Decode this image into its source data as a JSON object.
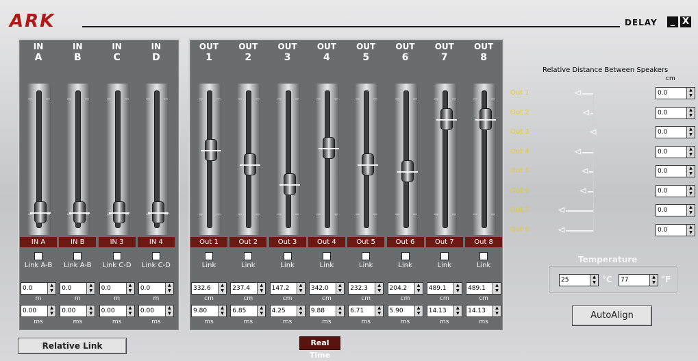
{
  "app": {
    "logo": "ARK",
    "title": "DELAY",
    "minimize": "_",
    "close": "X"
  },
  "inputs": [
    {
      "header": "IN",
      "ch": "A",
      "label": "IN A",
      "link": "Link A-B",
      "value": "0.0",
      "ms": "0.00",
      "unit_top": "m",
      "unit_bottom": "ms",
      "level": 0.05
    },
    {
      "header": "IN",
      "ch": "B",
      "label": "IN B",
      "link": "Link A-B",
      "value": "0.0",
      "ms": "0.00",
      "unit_top": "m",
      "unit_bottom": "ms",
      "level": 0.05
    },
    {
      "header": "IN",
      "ch": "C",
      "label": "IN 3",
      "link": "Link C-D",
      "value": "0.0",
      "ms": "0.00",
      "unit_top": "m",
      "unit_bottom": "ms",
      "level": 0.05
    },
    {
      "header": "IN",
      "ch": "D",
      "label": "IN 4",
      "link": "Link C-D",
      "value": "0.0",
      "ms": "0.00",
      "unit_top": "m",
      "unit_bottom": "ms",
      "level": 0.05
    }
  ],
  "outputs": [
    {
      "header": "OUT",
      "ch": "1",
      "label": "Out 1",
      "link": "Link",
      "value": "332.6",
      "ms": "9.80",
      "unit_top": "cm",
      "unit_bottom": "ms",
      "level": 0.58
    },
    {
      "header": "OUT",
      "ch": "2",
      "label": "Out 2",
      "link": "Link",
      "value": "237.4",
      "ms": "6.85",
      "unit_top": "cm",
      "unit_bottom": "ms",
      "level": 0.46
    },
    {
      "header": "OUT",
      "ch": "3",
      "label": "Out 3",
      "link": "Link",
      "value": "147.2",
      "ms": "4.25",
      "unit_top": "cm",
      "unit_bottom": "ms",
      "level": 0.29
    },
    {
      "header": "OUT",
      "ch": "4",
      "label": "Out 4",
      "link": "Link",
      "value": "342.0",
      "ms": "9.88",
      "unit_top": "cm",
      "unit_bottom": "ms",
      "level": 0.6
    },
    {
      "header": "OUT",
      "ch": "5",
      "label": "Out 5",
      "link": "Link",
      "value": "232.3",
      "ms": "6.71",
      "unit_top": "cm",
      "unit_bottom": "ms",
      "level": 0.46
    },
    {
      "header": "OUT",
      "ch": "6",
      "label": "Out 6",
      "link": "Link",
      "value": "204.2",
      "ms": "5.90",
      "unit_top": "cm",
      "unit_bottom": "ms",
      "level": 0.4
    },
    {
      "header": "OUT",
      "ch": "7",
      "label": "Out 7",
      "link": "Link",
      "value": "489.1",
      "ms": "14.13",
      "unit_top": "cm",
      "unit_bottom": "ms",
      "level": 0.85
    },
    {
      "header": "OUT",
      "ch": "8",
      "label": "Out 8",
      "link": "Link",
      "value": "489.1",
      "ms": "14.13",
      "unit_top": "cm",
      "unit_bottom": "ms",
      "level": 0.85
    }
  ],
  "relative_link": "Relative Link",
  "real_time": "Real Time",
  "relative_distance": {
    "title": "Relative Distance Between Speakers",
    "unit": "cm",
    "rows": [
      {
        "label": "Out 1",
        "value": "0.0",
        "offset": 0.45
      },
      {
        "label": "Out 2",
        "value": "0.0",
        "offset": 0.25
      },
      {
        "label": "Out 3",
        "value": "0.0",
        "offset": 0.08
      },
      {
        "label": "Out 4",
        "value": "0.0",
        "offset": 0.45
      },
      {
        "label": "Out 5",
        "value": "0.0",
        "offset": 0.28
      },
      {
        "label": "Out 6",
        "value": "0.0",
        "offset": 0.32
      },
      {
        "label": "Out 7",
        "value": "0.0",
        "offset": 0.85
      },
      {
        "label": "Out 8",
        "value": "0.0",
        "offset": 0.85
      }
    ]
  },
  "temperature": {
    "title": "Temperature",
    "celsius": "25",
    "c_unit": "°C",
    "fahrenheit": "77",
    "f_unit": "°F"
  },
  "auto_align": "AutoAlign",
  "colors": {
    "channel_label_bg": "#6a1a12",
    "distance_label": "#e0cc30",
    "logo": "#b01818"
  }
}
